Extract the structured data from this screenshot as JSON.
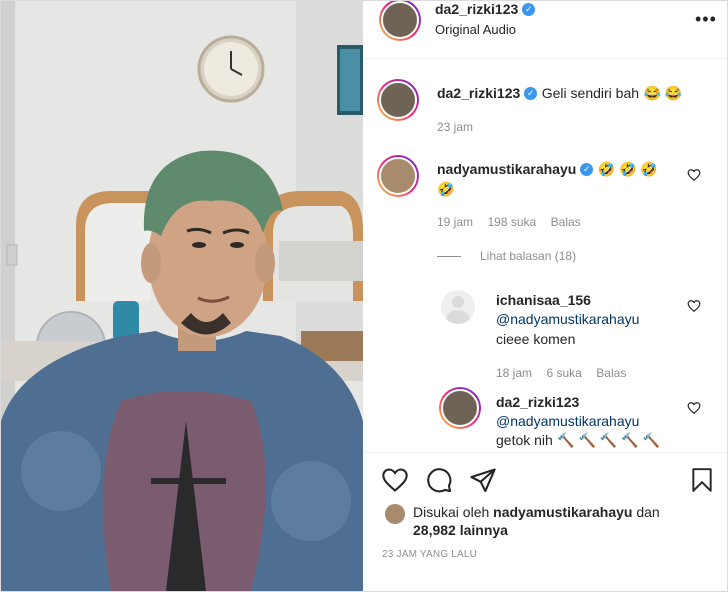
{
  "header": {
    "username": "da2_rizki123",
    "subtitle": "Original Audio"
  },
  "caption": {
    "username": "da2_rizki123",
    "text": "Geli sendiri bah",
    "emoji": "😂 😂",
    "time": "23 jam"
  },
  "comments": [
    {
      "username": "nadyamustikarahayu",
      "text": "🤣 🤣 🤣",
      "text2": "🤣",
      "time": "19 jam",
      "likes": "198 suka",
      "reply": "Balas",
      "view_replies": "Lihat balasan (18)"
    },
    {
      "username": "ichanisaa_156",
      "mention": "@nadyamustikarahayu",
      "text": "cieee komen",
      "time": "18 jam",
      "likes": "6 suka",
      "reply": "Balas"
    },
    {
      "username": "da2_rizki123",
      "mention": "@nadyamustikarahayu",
      "text": "getok nih",
      "emoji": "🔨 🔨 🔨 🔨 🔨"
    }
  ],
  "likes": {
    "prefix": "Disukai oleh",
    "user": "nadyamustikarahayu",
    "and": "dan",
    "count": "28,982",
    "suffix": "lainnya"
  },
  "timestamp": "23 JAM YANG LALU",
  "icons": [
    "more-icon",
    "verified-icon",
    "heart-icon",
    "comment-icon",
    "share-icon",
    "bookmark-icon"
  ]
}
